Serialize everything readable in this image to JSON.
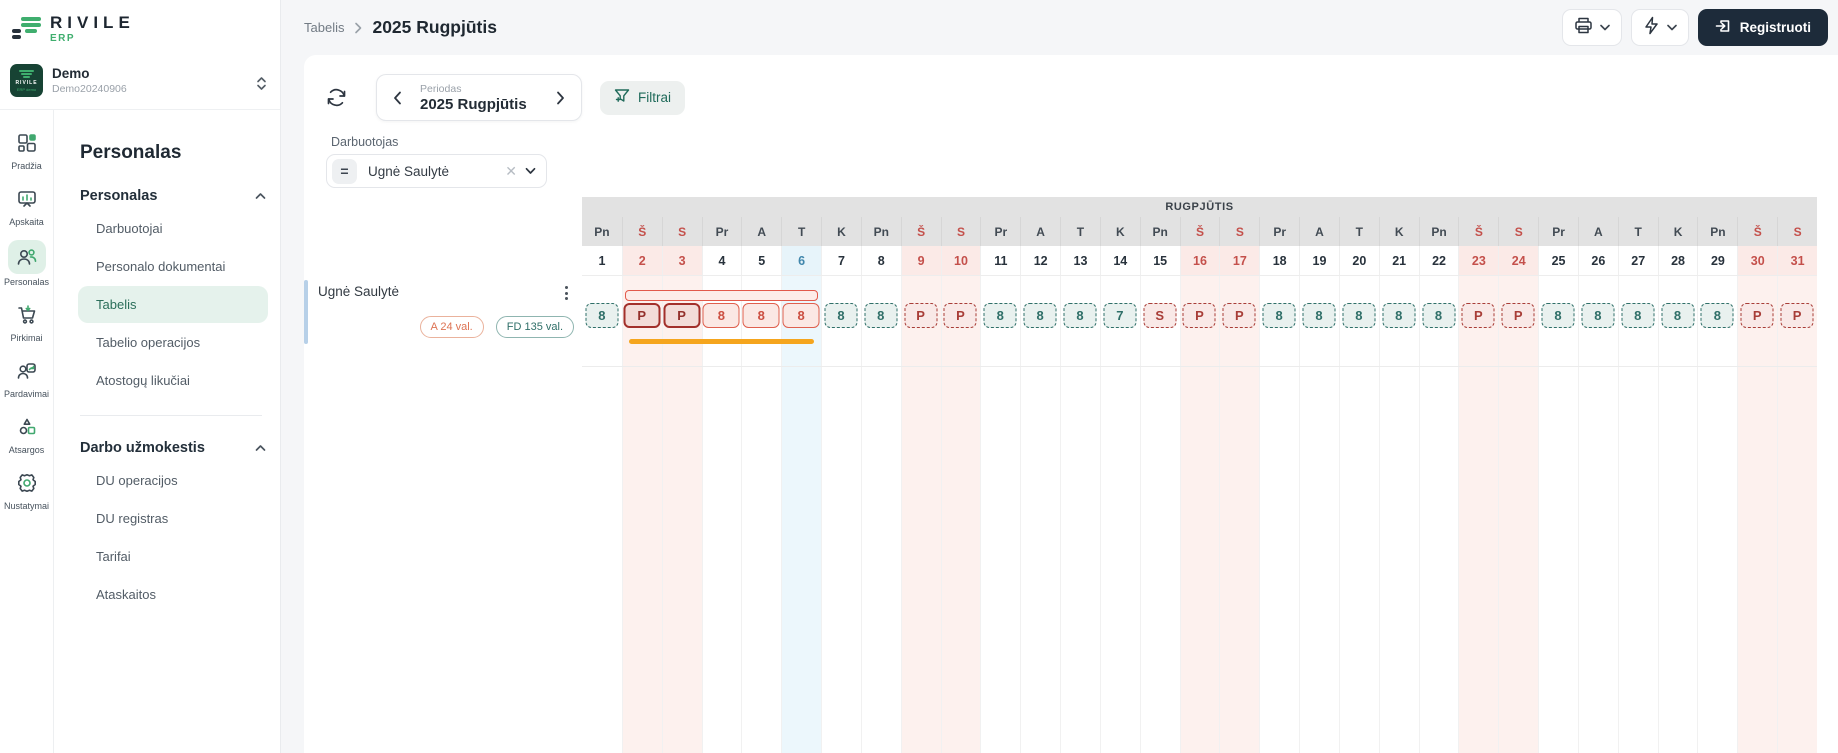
{
  "brand": {
    "name": "RIVILE",
    "sub": "ERP"
  },
  "workspace": {
    "name": "Demo",
    "code": "Demo20240906"
  },
  "rail": {
    "items": [
      {
        "label": "Pradžia",
        "icon": "home-grid",
        "active": false
      },
      {
        "label": "Apskaita",
        "icon": "accounting-board",
        "active": false
      },
      {
        "label": "Personalas",
        "icon": "people",
        "active": true
      },
      {
        "label": "Pirkimai",
        "icon": "cart",
        "active": false
      },
      {
        "label": "Pardavimai",
        "icon": "sales",
        "active": false
      },
      {
        "label": "Atsargos",
        "icon": "shapes",
        "active": false
      },
      {
        "label": "Nustatymai",
        "icon": "gear",
        "active": false
      }
    ]
  },
  "menu": {
    "title": "Personalas",
    "sections": [
      {
        "header": "Personalas",
        "items": [
          {
            "label": "Darbuotojai",
            "active": false
          },
          {
            "label": "Personalo dokumentai",
            "active": false
          },
          {
            "label": "Tabelis",
            "active": true
          },
          {
            "label": "Tabelio operacijos",
            "active": false
          },
          {
            "label": "Atostogų likučiai",
            "active": false
          }
        ]
      },
      {
        "header": "Darbo užmokestis",
        "items": [
          {
            "label": "DU operacijos",
            "active": false
          },
          {
            "label": "DU registras",
            "active": false
          },
          {
            "label": "Tarifai",
            "active": false
          },
          {
            "label": "Ataskaitos",
            "active": false
          }
        ]
      }
    ]
  },
  "topbar": {
    "breadcrumb": "Tabelis",
    "title": "2025 Rugpjūtis",
    "register_label": "Registruoti"
  },
  "toolbar": {
    "period_label": "Periodas",
    "period_value": "2025 Rugpjūtis",
    "filter_button_label": "Filtrai"
  },
  "filter": {
    "label": "Darbuotojas",
    "value": "Ugnė Saulytė"
  },
  "timesheet": {
    "month_header": "RUGPJŪTIS",
    "days": [
      {
        "n": 1,
        "wd": "Pn"
      },
      {
        "n": 2,
        "wd": "Š",
        "we": true
      },
      {
        "n": 3,
        "wd": "S",
        "we": true
      },
      {
        "n": 4,
        "wd": "Pr"
      },
      {
        "n": 5,
        "wd": "A"
      },
      {
        "n": 6,
        "wd": "T",
        "today": true
      },
      {
        "n": 7,
        "wd": "K"
      },
      {
        "n": 8,
        "wd": "Pn"
      },
      {
        "n": 9,
        "wd": "Š",
        "we": true
      },
      {
        "n": 10,
        "wd": "S",
        "we": true
      },
      {
        "n": 11,
        "wd": "Pr"
      },
      {
        "n": 12,
        "wd": "A"
      },
      {
        "n": 13,
        "wd": "T"
      },
      {
        "n": 14,
        "wd": "K"
      },
      {
        "n": 15,
        "wd": "Pn"
      },
      {
        "n": 16,
        "wd": "Š",
        "we": true
      },
      {
        "n": 17,
        "wd": "S",
        "we": true
      },
      {
        "n": 18,
        "wd": "Pr"
      },
      {
        "n": 19,
        "wd": "A"
      },
      {
        "n": 20,
        "wd": "T"
      },
      {
        "n": 21,
        "wd": "K"
      },
      {
        "n": 22,
        "wd": "Pn"
      },
      {
        "n": 23,
        "wd": "Š",
        "we": true
      },
      {
        "n": 24,
        "wd": "S",
        "we": true
      },
      {
        "n": 25,
        "wd": "Pr"
      },
      {
        "n": 26,
        "wd": "A"
      },
      {
        "n": 27,
        "wd": "T"
      },
      {
        "n": 28,
        "wd": "K"
      },
      {
        "n": 29,
        "wd": "Pn"
      },
      {
        "n": 30,
        "wd": "Š",
        "we": true
      },
      {
        "n": 31,
        "wd": "S",
        "we": true
      }
    ],
    "employee": {
      "name": "Ugnė Saulytė",
      "badges": [
        {
          "text": "A 24 val.",
          "kind": "absence"
        },
        {
          "text": "FD 135 val.",
          "kind": "worked"
        }
      ],
      "cells": [
        {
          "d": 1,
          "v": "8",
          "t": "work"
        },
        {
          "d": 2,
          "v": "P",
          "t": "sel-dark"
        },
        {
          "d": 3,
          "v": "P",
          "t": "sel-dark"
        },
        {
          "d": 4,
          "v": "8",
          "t": "sel-light"
        },
        {
          "d": 5,
          "v": "8",
          "t": "sel-light"
        },
        {
          "d": 6,
          "v": "8",
          "t": "sel-light"
        },
        {
          "d": 7,
          "v": "8",
          "t": "work"
        },
        {
          "d": 8,
          "v": "8",
          "t": "work"
        },
        {
          "d": 9,
          "v": "P",
          "t": "abs"
        },
        {
          "d": 10,
          "v": "P",
          "t": "abs"
        },
        {
          "d": 11,
          "v": "8",
          "t": "work"
        },
        {
          "d": 12,
          "v": "8",
          "t": "work"
        },
        {
          "d": 13,
          "v": "8",
          "t": "work"
        },
        {
          "d": 14,
          "v": "7",
          "t": "work"
        },
        {
          "d": 15,
          "v": "S",
          "t": "abs"
        },
        {
          "d": 16,
          "v": "P",
          "t": "abs"
        },
        {
          "d": 17,
          "v": "P",
          "t": "abs"
        },
        {
          "d": 18,
          "v": "8",
          "t": "work"
        },
        {
          "d": 19,
          "v": "8",
          "t": "work"
        },
        {
          "d": 20,
          "v": "8",
          "t": "work"
        },
        {
          "d": 21,
          "v": "8",
          "t": "work"
        },
        {
          "d": 22,
          "v": "8",
          "t": "work"
        },
        {
          "d": 23,
          "v": "P",
          "t": "abs"
        },
        {
          "d": 24,
          "v": "P",
          "t": "abs"
        },
        {
          "d": 25,
          "v": "8",
          "t": "work"
        },
        {
          "d": 26,
          "v": "8",
          "t": "work"
        },
        {
          "d": 27,
          "v": "8",
          "t": "work"
        },
        {
          "d": 28,
          "v": "8",
          "t": "work"
        },
        {
          "d": 29,
          "v": "8",
          "t": "work"
        },
        {
          "d": 30,
          "v": "P",
          "t": "abs"
        },
        {
          "d": 31,
          "v": "P",
          "t": "abs"
        }
      ],
      "overlays": {
        "bracket": {
          "from": 2,
          "to": 6
        },
        "underline": {
          "from": 2,
          "to": 6
        }
      }
    }
  },
  "colors": {
    "brand_green": "#3fae6e",
    "active_menu_bg": "#e5f2ec",
    "register_button_bg": "#1d2b3a",
    "weekend_red": "#c4504b",
    "weekend_stripe": "#fdf1ee",
    "today_blue": "#4187ac",
    "today_stripe": "#ecf7fc",
    "work_chip_teal": "#2f6f68",
    "absence_chip_red": "#a83d37",
    "selection_red": "#df604e",
    "underline_orange": "#f5a51d"
  }
}
